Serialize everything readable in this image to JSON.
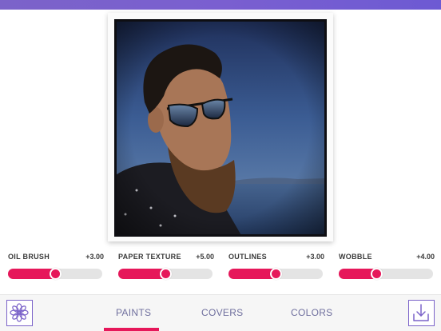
{
  "header": {
    "accent_color": "#7b63c9"
  },
  "photo": {
    "description_icon": "watercolor-portrait"
  },
  "sliders": [
    {
      "label": "OIL BRUSH",
      "value_text": "+3.00",
      "level_percent": 50
    },
    {
      "label": "PAPER TEXTURE",
      "value_text": "+5.00",
      "level_percent": 50
    },
    {
      "label": "OUTLINES",
      "value_text": "+3.00",
      "level_percent": 50
    },
    {
      "label": "WOBBLE",
      "value_text": "+4.00",
      "level_percent": 40
    }
  ],
  "tabs": [
    {
      "label": "PAINTS",
      "selected": true
    },
    {
      "label": "COVERS",
      "selected": false
    },
    {
      "label": "COLORS",
      "selected": false
    }
  ],
  "icons": {
    "left": "flower-icon",
    "right": "download-icon"
  },
  "colors": {
    "accent": "#e6175a",
    "brand": "#7b63c9"
  }
}
